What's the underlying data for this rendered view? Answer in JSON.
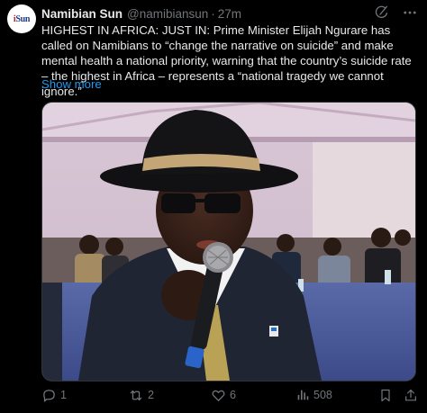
{
  "account": {
    "name": "Namibian Sun",
    "handle": "@namibiansun",
    "separator": "·",
    "time": "27m",
    "avatar_text_a": "i",
    "avatar_text_b": "Sun"
  },
  "post": {
    "text": "HIGHEST IN AFRICA: JUST IN: Prime Minister Elijah Ngurare has called on Namibians to “change the narrative on suicide” and make mental health a national priority, warning that the country’s suicide rate – the highest in Africa – represents a “national tragedy we cannot ignore.”",
    "show_more": "Show more"
  },
  "actions": {
    "replies": "1",
    "reposts": "2",
    "likes": "6",
    "views": "508"
  },
  "colors": {
    "background": "#000000",
    "text": "#e7e9ea",
    "muted": "#71767b",
    "link": "#1d9bf0"
  },
  "icons": {
    "top": [
      "grok-icon",
      "more-icon"
    ],
    "actions": [
      "reply-icon",
      "repost-icon",
      "like-icon",
      "views-icon",
      "bookmark-icon",
      "share-icon"
    ]
  }
}
